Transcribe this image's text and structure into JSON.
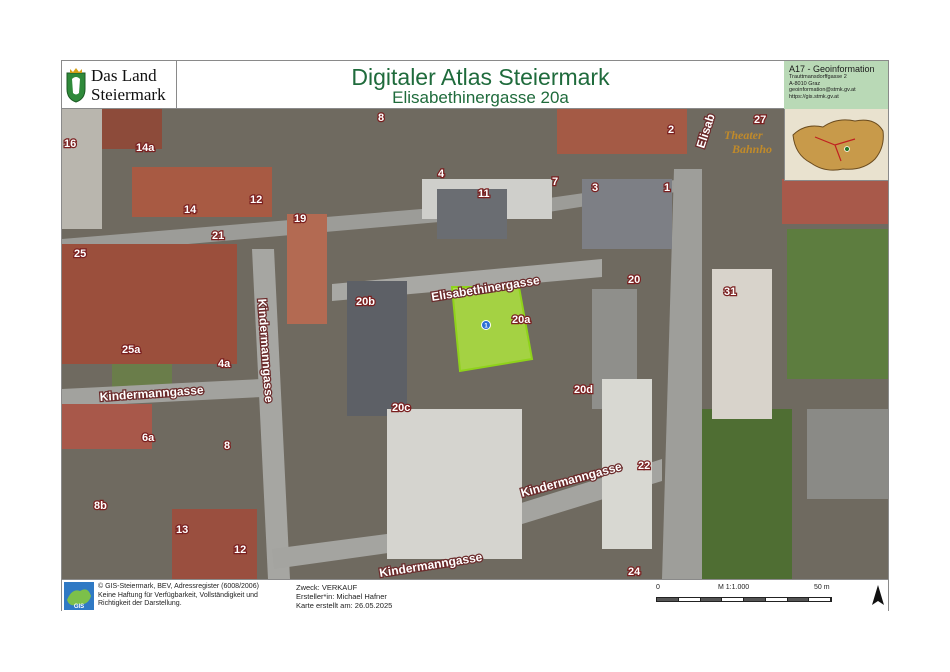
{
  "header": {
    "logo_line1": "Das Land",
    "logo_line2": "Steiermark",
    "title": "Digitaler Atlas Steiermark",
    "subtitle": "Elisabethinergasse 20a"
  },
  "infobox": {
    "org": "A17 - Geoinformation",
    "lines": [
      "Trauttmansdorffgasse 2",
      "A-8010 Graz",
      "geoinformation@stmk.gv.at",
      "https://gis.stmk.gv.at"
    ]
  },
  "map": {
    "streets": {
      "elisabethinergasse": "Elisabethinergasse",
      "kindermanngasse_w": "Kindermanngasse",
      "kindermanngasse_c": "Kindermanngasse",
      "kindermanngasse_s": "Kindermanngasse",
      "kindermanngasse_v": "Kindermanngasse",
      "elisab_e": "Elisab"
    },
    "poi": {
      "line1": "Theater",
      "line2": "Bahnho"
    },
    "parcel_marker": "1",
    "house_numbers": {
      "n16": "16",
      "n14a": "14a",
      "n14": "14",
      "n12a": "12",
      "n19": "19",
      "n4": "4",
      "n11": "11",
      "n7": "7",
      "n8": "8",
      "n2": "2",
      "n3": "3",
      "n1": "1",
      "n27": "27",
      "n25": "25",
      "n21": "21",
      "n20b": "20b",
      "n20a": "20a",
      "n20": "20",
      "n31": "31",
      "n25a": "25a",
      "n4a": "4a",
      "n20c": "20c",
      "n20d": "20d",
      "n6a": "6a",
      "n22": "22",
      "n8b": "8b",
      "n13": "13",
      "n12b": "12",
      "n24": "24"
    }
  },
  "footer": {
    "copyright": "© GIS-Steiermark, BEV, Adressregister (6008/2006)",
    "disclaimer": "Keine Haftung für Verfügbarkeit, Vollständigkeit und Richtigkeit der Darstellung.",
    "zweck": "Zweck: VERKAUF",
    "ersteller": "Ersteller*in: Michael Hafner",
    "erstellt": "Karte erstellt am: 26.05.2025",
    "scale_zero": "0",
    "scale_ratio": "M 1:1.000",
    "scale_end": "50 m"
  },
  "colors": {
    "title_green": "#1f6b3c",
    "info_bg": "#b9d9b6",
    "parcel_fill": "#b6f53a",
    "label_stroke": "#6b2b2b"
  }
}
